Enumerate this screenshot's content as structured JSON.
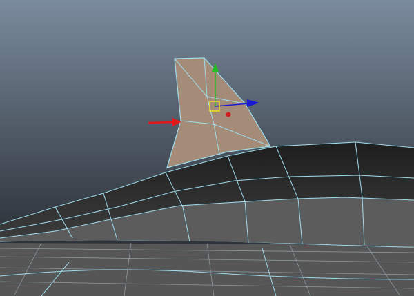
{
  "viewport": {
    "type": "3d-viewport",
    "background_top": "#7a8b9d",
    "background_bottom": "#2a2e34",
    "wireframe_color": "#9fdcec",
    "selected_face_color": "#a58c78",
    "mesh_dark_color": "#262626",
    "mesh_light_color": "#5a5a5a"
  },
  "annotations": {
    "pointer_arrow": {
      "icon": "red-arrow-icon",
      "color": "#e01818"
    }
  },
  "manipulator": {
    "icon": "move-tool-manipulator-icon",
    "y_axis_color": "#22c022",
    "x_axis_color": "#1a1ad0",
    "center_color": "#f0e020",
    "pivot_color": "#d02020"
  }
}
